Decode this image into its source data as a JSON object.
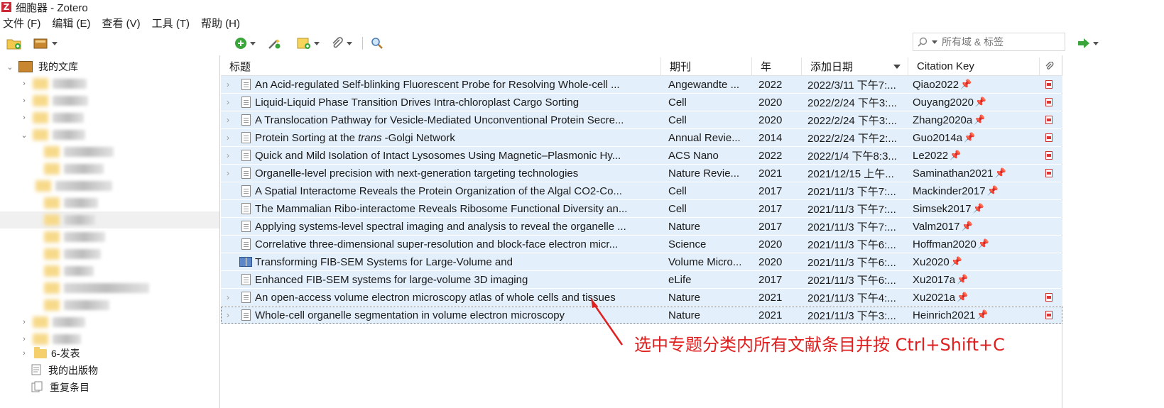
{
  "window": {
    "title": "细胞器 - Zotero",
    "logo": "Z"
  },
  "menu": [
    "文件 (F)",
    "编辑 (E)",
    "查看 (V)",
    "工具 (T)",
    "帮助 (H)"
  ],
  "search": {
    "placeholder": "所有域 & 标签"
  },
  "sidebar": {
    "library": "我的文库",
    "visible_items": [
      {
        "label": "6-发表"
      },
      {
        "label": "我的出版物"
      },
      {
        "label": "重复条目"
      }
    ]
  },
  "table": {
    "columns": [
      "标题",
      "期刊",
      "年",
      "添加日期",
      "Citation Key"
    ],
    "rows": [
      {
        "title": "An Acid-regulated Self-blinking Fluorescent Probe for Resolving Whole-cell ...",
        "journal": "Angewandte ...",
        "year": "2022",
        "date": "2022/3/11 下午7:...",
        "key": "Qiao2022",
        "icon": "doc-icon",
        "expandable": true,
        "pdf": true
      },
      {
        "title": "Liquid-Liquid Phase Transition Drives Intra-chloroplast Cargo Sorting",
        "journal": "Cell",
        "year": "2020",
        "date": "2022/2/24 下午3:...",
        "key": "Ouyang2020",
        "icon": "doc-icon",
        "expandable": true,
        "pdf": true
      },
      {
        "title": "A Translocation Pathway for Vesicle-Mediated Unconventional Protein Secre...",
        "journal": "Cell",
        "year": "2020",
        "date": "2022/2/24 下午3:...",
        "key": "Zhang2020a",
        "icon": "doc-icon",
        "expandable": true,
        "pdf": true
      },
      {
        "title_pre": "Protein Sorting at the ",
        "title_em": "trans",
        "title_post": " -Golgi Network",
        "journal": "Annual Revie...",
        "year": "2014",
        "date": "2022/2/24 下午2:...",
        "key": "Guo2014a",
        "icon": "doc-icon",
        "expandable": true,
        "pdf": true
      },
      {
        "title": "Quick and Mild Isolation of Intact Lysosomes Using Magnetic–Plasmonic Hy...",
        "journal": "ACS Nano",
        "year": "2022",
        "date": "2022/1/4 下午8:3...",
        "key": "Le2022",
        "icon": "doc-icon",
        "expandable": true,
        "pdf": true
      },
      {
        "title": "Organelle-level precision with next-generation targeting technologies",
        "journal": "Nature Revie...",
        "year": "2021",
        "date": "2021/12/15 上午...",
        "key": "Saminathan2021",
        "icon": "doc-icon",
        "expandable": true,
        "pdf": true
      },
      {
        "title": "A Spatial Interactome Reveals the Protein Organization of the Algal CO2-Co...",
        "journal": "Cell",
        "year": "2017",
        "date": "2021/11/3 下午7:...",
        "key": "Mackinder2017",
        "icon": "doc-icon",
        "expandable": false,
        "pdf": false
      },
      {
        "title": "The Mammalian Ribo-interactome Reveals Ribosome Functional Diversity an...",
        "journal": "Cell",
        "year": "2017",
        "date": "2021/11/3 下午7:...",
        "key": "Simsek2017",
        "icon": "doc-icon",
        "expandable": false,
        "pdf": false
      },
      {
        "title": "Applying systems-level spectral imaging and analysis to reveal the organelle ...",
        "journal": "Nature",
        "year": "2017",
        "date": "2021/11/3 下午7:...",
        "key": "Valm2017",
        "icon": "doc-icon",
        "expandable": false,
        "pdf": false
      },
      {
        "title": "Correlative three-dimensional super-resolution and block-face electron micr...",
        "journal": "Science",
        "year": "2020",
        "date": "2021/11/3 下午6:...",
        "key": "Hoffman2020",
        "icon": "doc-icon",
        "expandable": false,
        "pdf": false
      },
      {
        "title": "Transforming FIB-SEM Systems for Large-Volume and",
        "journal": "Volume Micro...",
        "year": "2020",
        "date": "2021/11/3 下午6:...",
        "key": "Xu2020",
        "icon": "book-icon",
        "expandable": false,
        "pdf": false
      },
      {
        "title": "Enhanced FIB-SEM systems for large-volume 3D imaging",
        "journal": "eLife",
        "year": "2017",
        "date": "2021/11/3 下午6:...",
        "key": "Xu2017a",
        "icon": "doc-icon",
        "expandable": false,
        "pdf": false
      },
      {
        "title": "An open-access volume electron microscopy atlas of whole cells and tissues",
        "journal": "Nature",
        "year": "2021",
        "date": "2021/11/3 下午4:...",
        "key": "Xu2021a",
        "icon": "doc-icon",
        "expandable": true,
        "pdf": true
      },
      {
        "title": "Whole-cell organelle segmentation in volume electron microscopy",
        "journal": "Nature",
        "year": "2021",
        "date": "2021/11/3 下午3:...",
        "key": "Heinrich2021",
        "icon": "doc-icon",
        "expandable": true,
        "pdf": true
      }
    ]
  },
  "annotation": {
    "text": "选中专题分类内所有文献条目并按 Ctrl+Shift+C",
    "color": "#e02020"
  },
  "colors": {
    "selection": "#e3effb",
    "accent": "#3b7bd4",
    "pin": "#e02020"
  }
}
